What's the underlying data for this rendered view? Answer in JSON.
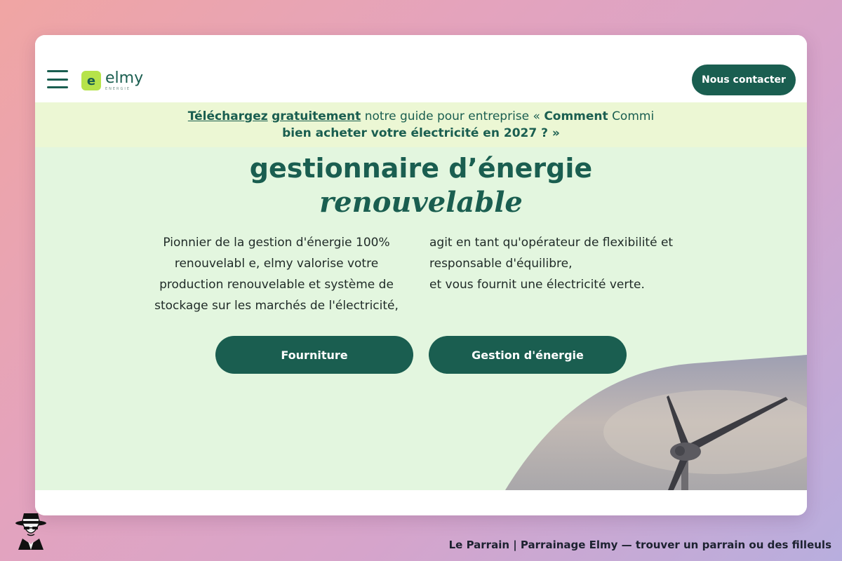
{
  "nav": {
    "logo_mark": "e",
    "logo_text": "elmy",
    "logo_sub": "ENERGIE",
    "contact_label": "Nous contacter"
  },
  "banner": {
    "link1": "Téléchargez",
    "link2": "gratuitement",
    "text1": "notre guide pour entreprise «",
    "bold1": "Comment",
    "text2": "Commi",
    "line2": "bien acheter votre électricité en 2027 ? »"
  },
  "hero": {
    "title": "gestionnaire d’énergie",
    "title_accent": "renouvelable",
    "left_lines": [
      "Pionnier de la gestion d'énergie 100%",
      "renouvelabl e, elmy valorise votre",
      "production renouvelable et système de",
      "stockage sur les marchés de l'électricité,"
    ],
    "right_lines": [
      "agit en tant qu'opérateur de flexibilité et",
      "responsable d'équilibre,",
      "et vous fournit une électricité verte."
    ],
    "btn_fourniture": "Fourniture",
    "btn_gestion": "Gestion d'énergie"
  },
  "caption": "Le Parrain | Parrainage Elmy — trouver un parrain ou des filleuls",
  "colors": {
    "brand": "#1a5e50",
    "logo_accent": "#b6e34a",
    "hero_bg": "#e3f6df",
    "banner_bg": "#ecf7d4"
  }
}
